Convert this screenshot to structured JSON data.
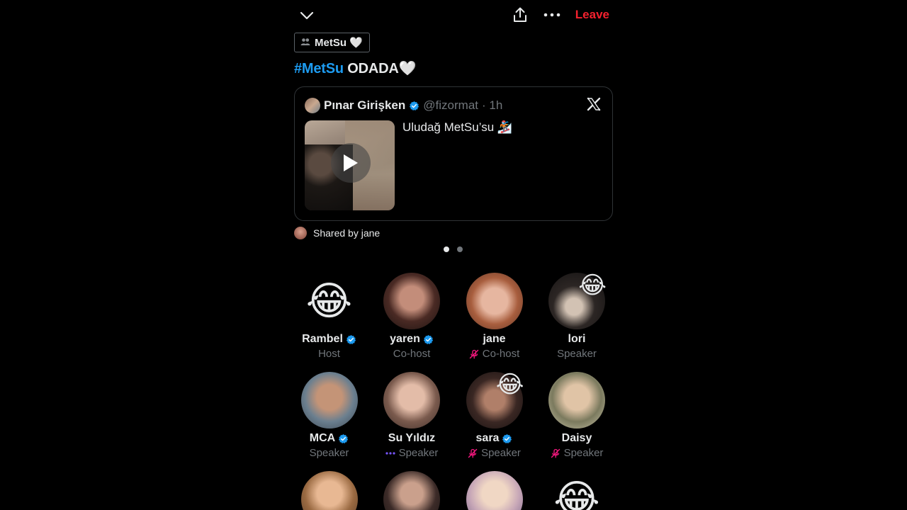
{
  "topbar": {
    "leave_label": "Leave"
  },
  "community": {
    "label": "MetSu 🤍"
  },
  "space": {
    "hashtag": "#MetSu",
    "title_rest": " ODADA🤍"
  },
  "tweet": {
    "author_name": "Pınar Girişken",
    "handle": "@fizormat",
    "time": "· 1h",
    "text": "Uludağ MetSu’su 🏂"
  },
  "shared": {
    "label": "Shared by jane"
  },
  "carousel": {
    "pages": 2,
    "active": 0
  },
  "participants": [
    {
      "name": "Rambel",
      "role": "Host",
      "verified": true,
      "muted": false,
      "emoji_avatar": "😂",
      "reaction": ""
    },
    {
      "name": "yaren",
      "role": "Co-host",
      "verified": true,
      "muted": false,
      "emoji_avatar": "",
      "reaction": ""
    },
    {
      "name": "jane",
      "role": "Co-host",
      "verified": false,
      "muted": true,
      "emoji_avatar": "",
      "reaction": ""
    },
    {
      "name": "lori",
      "role": "Speaker",
      "verified": false,
      "muted": false,
      "emoji_avatar": "",
      "reaction": "😂"
    },
    {
      "name": "MCA",
      "role": "Speaker",
      "verified": true,
      "muted": false,
      "emoji_avatar": "",
      "reaction": ""
    },
    {
      "name": "Su Yıldız",
      "role": "Speaker",
      "verified": false,
      "muted": false,
      "speaking": true,
      "emoji_avatar": "",
      "reaction": ""
    },
    {
      "name": "sara",
      "role": "Speaker",
      "verified": true,
      "muted": true,
      "emoji_avatar": "",
      "reaction": "😂"
    },
    {
      "name": "Daisy",
      "role": "Speaker",
      "verified": false,
      "muted": true,
      "emoji_avatar": "",
      "reaction": ""
    },
    {
      "name": "",
      "role": "",
      "verified": false,
      "muted": false,
      "emoji_avatar": "",
      "reaction": ""
    },
    {
      "name": "",
      "role": "",
      "verified": false,
      "muted": false,
      "emoji_avatar": "",
      "reaction": ""
    },
    {
      "name": "",
      "role": "",
      "verified": false,
      "muted": false,
      "emoji_avatar": "",
      "reaction": ""
    },
    {
      "name": "",
      "role": "",
      "verified": false,
      "muted": false,
      "emoji_avatar": "😂",
      "reaction": ""
    }
  ],
  "colors": {
    "accent": "#1d9bf0",
    "leave": "#f4212e",
    "muted_mic": "#f91880",
    "secondary_text": "#71767b"
  },
  "icons": {
    "collapse": "chevron-down-icon",
    "share": "share-icon",
    "more": "more-icon",
    "community": "community-icon",
    "x_logo": "x-logo-icon",
    "play": "play-icon",
    "verified": "verified-badge-icon",
    "mic_off": "mic-off-icon",
    "speaking": "speaking-dots-icon"
  }
}
